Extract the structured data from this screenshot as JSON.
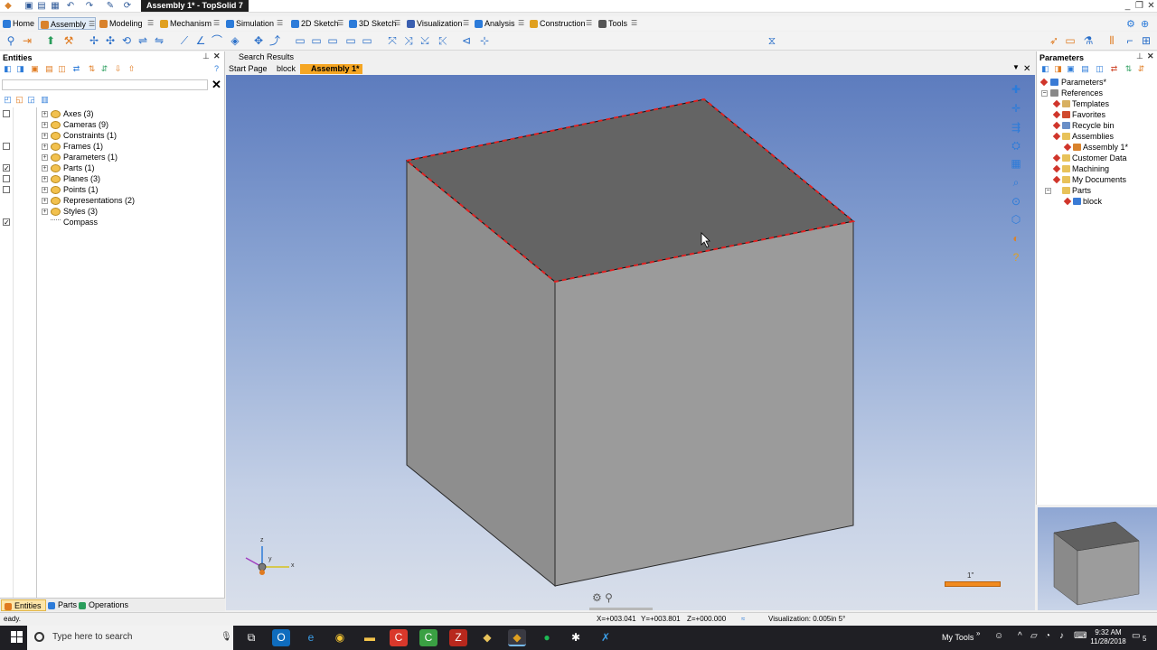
{
  "window": {
    "title": "Assembly 1* - TopSolid 7",
    "controls": [
      "_",
      "❐",
      "✕"
    ],
    "quick_access_icons": [
      "app-icon",
      "save-icon",
      "save-all-icon",
      "print-icon",
      "undo-icon",
      "redo-icon",
      "pen-icon",
      "refresh-icon"
    ]
  },
  "menu": {
    "items": [
      {
        "label": "Home",
        "color": "#2c7bd9"
      },
      {
        "label": "Assembly",
        "color": "#d9822c"
      },
      {
        "label": "Modeling",
        "color": "#d9822c"
      },
      {
        "label": "Mechanism",
        "color": "#e0a020"
      },
      {
        "label": "Simulation",
        "color": "#2c7bd9"
      },
      {
        "label": "2D Sketch",
        "color": "#2c7bd9"
      },
      {
        "label": "3D Sketch",
        "color": "#2c7bd9"
      },
      {
        "label": "Visualization",
        "color": "#3a5fb0"
      },
      {
        "label": "Analysis",
        "color": "#2c7bd9"
      },
      {
        "label": "Construction",
        "color": "#e0a020"
      },
      {
        "label": "Tools",
        "color": "#555555"
      }
    ],
    "active": "Assembly"
  },
  "entities": {
    "title": "Entities",
    "tree": [
      {
        "label": "Axes (3)",
        "checked": false,
        "has_checkbox": true
      },
      {
        "label": "Cameras (9)",
        "checked": false,
        "has_checkbox": false
      },
      {
        "label": "Constraints (1)",
        "checked": false,
        "has_checkbox": false
      },
      {
        "label": "Frames (1)",
        "checked": false,
        "has_checkbox": true
      },
      {
        "label": "Parameters (1)",
        "checked": false,
        "has_checkbox": false
      },
      {
        "label": "Parts (1)",
        "checked": true,
        "has_checkbox": true
      },
      {
        "label": "Planes (3)",
        "checked": false,
        "has_checkbox": true
      },
      {
        "label": "Points (1)",
        "checked": false,
        "has_checkbox": true
      },
      {
        "label": "Representations (2)",
        "checked": false,
        "has_checkbox": false
      },
      {
        "label": "Styles (3)",
        "checked": false,
        "has_checkbox": false
      },
      {
        "label": "Compass",
        "checked": true,
        "has_checkbox": true
      }
    ],
    "bottom_tabs": [
      "Entities",
      "Parts",
      "Operations"
    ],
    "active_tab": "Entities"
  },
  "document": {
    "tabs_top": [
      "Search Results"
    ],
    "tabs": [
      "Start Page",
      "block",
      "Assembly 1*"
    ],
    "active_tab": "Assembly 1*",
    "compass_axes": {
      "x": "x",
      "y": "y",
      "z": "z"
    },
    "scale_label": "1\""
  },
  "parameters": {
    "title": "Parameters",
    "tree": [
      {
        "label": "Parameters*",
        "level": 0,
        "icon_color": "#3a7bd5"
      },
      {
        "label": "References",
        "level": 0,
        "icon_color": "#888888"
      },
      {
        "label": "Templates",
        "level": 1,
        "icon_color": "#d8b060"
      },
      {
        "label": "Favorites",
        "level": 1,
        "icon_color": "#d04a2e"
      },
      {
        "label": "Recycle bin",
        "level": 1,
        "icon_color": "#6a8fc7"
      },
      {
        "label": "Assemblies",
        "level": 1,
        "icon_color": "#e8c25a"
      },
      {
        "label": "Assembly 1*",
        "level": 2,
        "icon_color": "#d9822c"
      },
      {
        "label": "Customer Data",
        "level": 1,
        "icon_color": "#e8c25a"
      },
      {
        "label": "Machining",
        "level": 1,
        "icon_color": "#e8c25a"
      },
      {
        "label": "My Documents",
        "level": 1,
        "icon_color": "#e8c25a"
      },
      {
        "label": "Parts",
        "level": 1,
        "icon_color": "#e8c25a"
      },
      {
        "label": "block",
        "level": 2,
        "icon_color": "#3a7bd5"
      }
    ]
  },
  "status": {
    "left": "eady.",
    "x": "X=+003.041",
    "y": "Y=+003.801",
    "z": "Z=+000.000",
    "visualization": "Visualization: 0.005in 5°"
  },
  "taskbar": {
    "search_placeholder": "Type here to search",
    "apps": [
      "task-view-icon",
      "outlook-icon",
      "edge-icon",
      "chrome-icon",
      "file-explorer-icon",
      "app-red-icon",
      "app-green-icon",
      "filezilla-icon",
      "app-yellow-icon",
      "topsolid-icon",
      "spotify-icon",
      "app-dark-icon",
      "app-blue-icon"
    ],
    "tray_label": "My Tools",
    "time": "9:32 AM",
    "date": "11/28/2018",
    "notifications": "5"
  },
  "colors": {
    "accent": "#f5a623",
    "edge_highlight": "#e02020",
    "viewport_top": "#5d7cbe",
    "viewport_bottom": "#d9dfea"
  }
}
